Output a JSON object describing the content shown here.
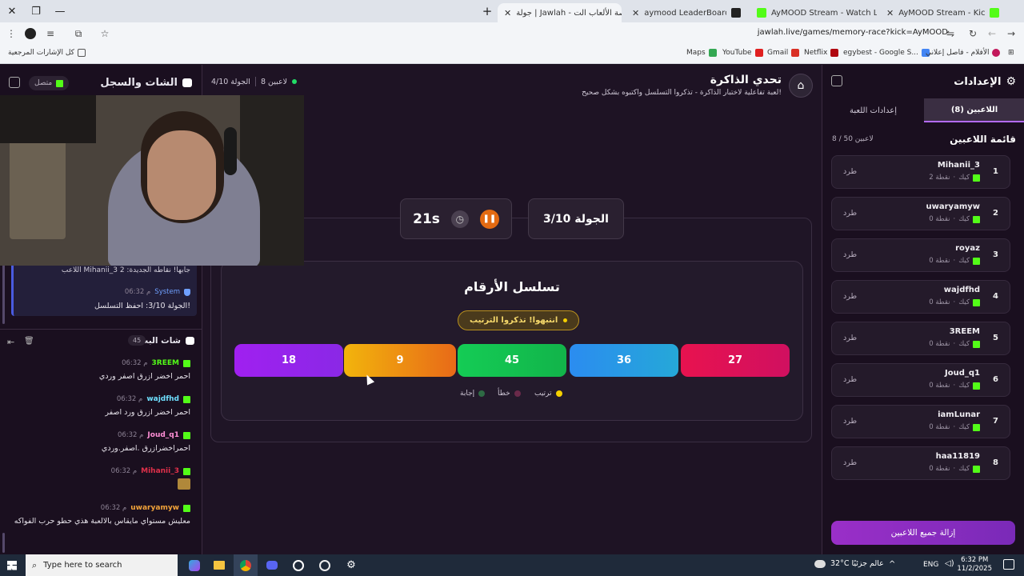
{
  "browser": {
    "tabs": [
      {
        "label": "جولة | Jawlah - منصة الألعاب الت",
        "active": true
      },
      {
        "label": "aymood LeaderBoard | The be",
        "active": false
      },
      {
        "label": "AyMOOD Stream - Watch Live",
        "active": false
      },
      {
        "label": "AyMOOD Stream - Kick Dashb",
        "active": false
      }
    ],
    "url": "jawlah.live/games/memory-race?kick=AyMOOD",
    "bookmarks": {
      "all_bookmarks": "كل الإشارات المرجعية",
      "items": [
        "Maps",
        "YouTube",
        "Gmail",
        "Netflix",
        "egybest - Google S...",
        "الأفلام - فاصل إعلاني"
      ]
    }
  },
  "chat_panel": {
    "title": "الشات والسجل",
    "status": "متصل",
    "round_info": "الجولة 4/10",
    "players_count": "8 لاعبين",
    "log": [
      {
        "text": "اللاعب Mihanii_3 جابها! نقاطه الجديدة: 2"
      },
      {
        "user": "System",
        "time": "06:32 م",
        "text": "الجولة 3/10: احفظ التسلسل!"
      }
    ],
    "stream_chat_title": "شات البث",
    "stream_chat_count": "45",
    "messages": [
      {
        "user": "3REEM",
        "time": "06:32 م",
        "text": "احمر اخضر ازرق اصفر وردي",
        "color": "#53fc18"
      },
      {
        "user": "wajdfhd",
        "time": "06:32 م",
        "text": "احمر اخضر ازرق ورد اصفر",
        "color": "#6fe0ff"
      },
      {
        "user": "Joud_q1",
        "time": "06:32 م",
        "text": "احمراخضرازرق .اصفر.وردي",
        "color": "#ff8fd6"
      },
      {
        "user": "Mihanii_3",
        "time": "06:32 م",
        "text": "",
        "color": "#e0304a"
      },
      {
        "user": "uwaryamyw",
        "time": "06:32 م",
        "text": "معليش مستواي مايقاس بالالعبة هذي حطو حرب الفواكه",
        "color": "#f2a33a"
      }
    ]
  },
  "game": {
    "title": "تحدي الذاكرة",
    "subtitle": "لعبة تفاعلية لاختبار الذاكرة - تذكروا التسلسل واكتبوه بشكل صحيح!",
    "timer": "21s",
    "round": "الجولة 3/10",
    "sequence_title": "تسلسل الأرقام",
    "hint": "انتبهوا! تذكروا الترتيب",
    "numbers": [
      {
        "value": "27",
        "color": "#e8124f"
      },
      {
        "value": "36",
        "color": "#2b8cf0"
      },
      {
        "value": "45",
        "color": "#14cc55"
      },
      {
        "value": "9",
        "color": "#f0a20c"
      },
      {
        "value": "18",
        "color": "#a020f0"
      }
    ],
    "legend": [
      {
        "label": "ترتيب",
        "color": "#f5d000"
      },
      {
        "label": "خطأ",
        "color": "#6a2a4a"
      },
      {
        "label": "إجابة",
        "color": "#2e6a44"
      }
    ]
  },
  "settings": {
    "title": "الإعدادات",
    "tab_players": "اللاعبين (8)",
    "tab_game_settings": "إعدادات اللعبة",
    "players_list_title": "قائمة اللاعبين",
    "players_capacity": "8 / 50 لاعبين",
    "kick_label": "طرد",
    "players": [
      {
        "rank": "1",
        "name": "Mihanii_3",
        "platform": "كيك",
        "points": "2 نقطة"
      },
      {
        "rank": "2",
        "name": "uwaryamyw",
        "platform": "كيك",
        "points": "0 نقطة"
      },
      {
        "rank": "3",
        "name": "royaz",
        "platform": "كيك",
        "points": "0 نقطة"
      },
      {
        "rank": "4",
        "name": "wajdfhd",
        "platform": "كيك",
        "points": "0 نقطة"
      },
      {
        "rank": "5",
        "name": "3REEM",
        "platform": "كيك",
        "points": "0 نقطة"
      },
      {
        "rank": "6",
        "name": "Joud_q1",
        "platform": "كيك",
        "points": "0 نقطة"
      },
      {
        "rank": "7",
        "name": "iamLunar",
        "platform": "كيك",
        "points": "0 نقطة"
      },
      {
        "rank": "8",
        "name": "haa11819",
        "platform": "كيك",
        "points": "0 نقطة"
      }
    ],
    "remove_all": "إزالة جميع اللاعبين"
  },
  "taskbar": {
    "search_placeholder": "Type here to search",
    "weather": "32°C عالم جزئيًا",
    "language": "ENG",
    "time": "6:32 PM",
    "date": "11/2/2025"
  }
}
